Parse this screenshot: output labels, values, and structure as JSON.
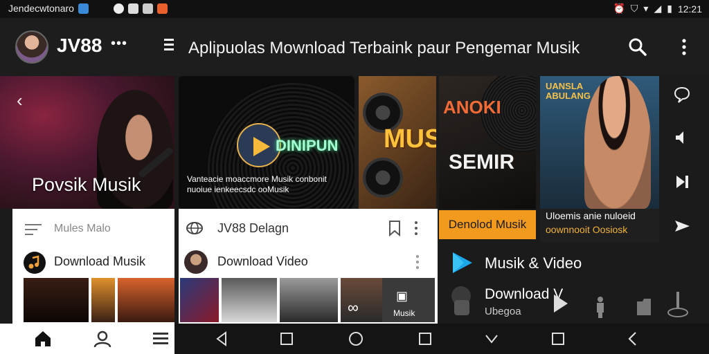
{
  "status_bar": {
    "left_text": "Jendecwtonaro",
    "time": "12:21"
  },
  "header": {
    "brand": "JV88",
    "brand_dots": "•••",
    "title": "Aplipuolas Mownload Terbaink paur Pengemar Musik"
  },
  "hero": [
    {
      "label": "Povsik Musik"
    },
    {
      "brand": "DINIPUN",
      "caption": "Vanteacie moaccmore Musik conbonit nuoiue ienkeecsdc ooMusik"
    },
    {
      "text": "MUSI"
    },
    {
      "title1": "ANOKI",
      "title2": "SEMIR",
      "button": "Denolod Musik"
    },
    {
      "logo": "UANSLA ABULANG",
      "caption1": "Uloemis anie nuloeid",
      "caption2": "oownnooit Oosiosk"
    }
  ],
  "left_card": {
    "menu_label": "Mules Malo",
    "download_label": "Download Musik"
  },
  "middle_card": {
    "title": "JV88 Delagn",
    "download_label": "Download Video",
    "thumb_label": "Musik"
  },
  "right_section": {
    "musik_video_label": "Musik & Video",
    "download_label": "Download V",
    "sub_label": "Ubegoa"
  },
  "colors": {
    "accent_orange": "#f29a1e",
    "background": "#1b1b1b"
  }
}
